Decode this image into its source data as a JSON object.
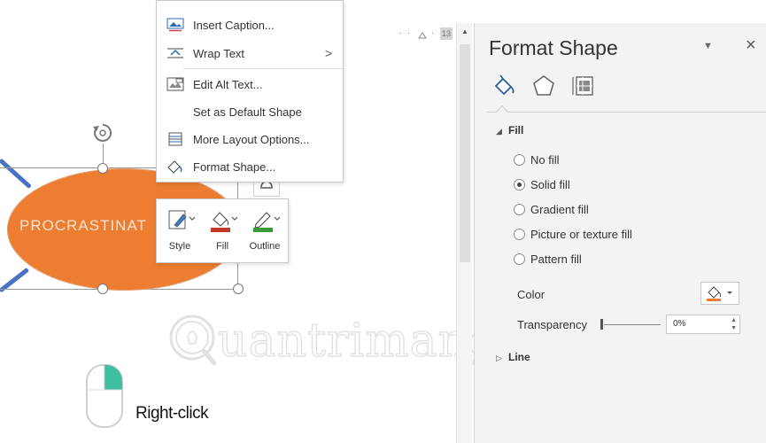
{
  "context_menu": {
    "items": [
      {
        "label": "Insert Caption...",
        "icon": "insert-caption-icon"
      },
      {
        "label": "Wrap Text",
        "icon": "wrap-text-icon",
        "submenu": true
      },
      {
        "label": "Edit Alt Text...",
        "icon": "alt-text-icon"
      },
      {
        "label": "Set as Default Shape",
        "icon": ""
      },
      {
        "label": "More Layout Options...",
        "icon": "layout-options-icon"
      },
      {
        "label": "Format Shape...",
        "icon": "format-shape-icon"
      }
    ],
    "submenu_arrow": ">"
  },
  "mini_toolbar": {
    "style_label": "Style",
    "fill_label": "Fill",
    "outline_label": "Outline"
  },
  "shape": {
    "text": "PROCRASTINAT",
    "fill_color": "#ed7d31"
  },
  "ruler": {
    "number": "13"
  },
  "watermark": {
    "text": "uantrimang"
  },
  "mouse": {
    "label": "Right-click",
    "accent_color": "#3fbfa0"
  },
  "format_pane": {
    "title": "Format Shape",
    "dropdown_glyph": "▼",
    "close_glyph": "×",
    "fill_section": {
      "heading": "Fill",
      "options": [
        {
          "label": "No fill",
          "selected": false
        },
        {
          "label": "Solid fill",
          "selected": true
        },
        {
          "label": "Gradient fill",
          "selected": false
        },
        {
          "label": "Picture or texture fill",
          "selected": false
        },
        {
          "label": "Pattern fill",
          "selected": false
        }
      ],
      "color_label": "Color",
      "transparency_label": "Transparency",
      "transparency_value": "0%"
    },
    "line_section": {
      "heading": "Line"
    }
  }
}
